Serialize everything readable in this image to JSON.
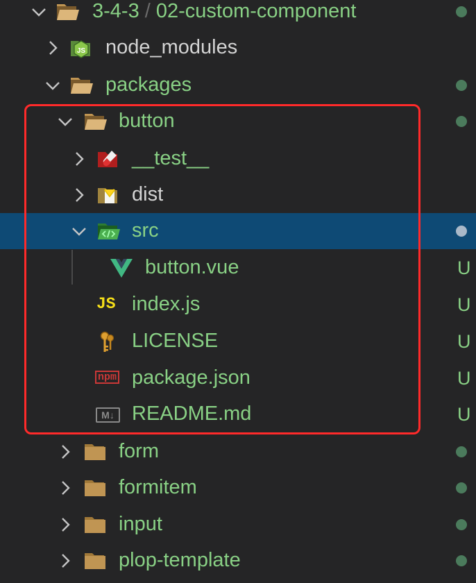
{
  "colors": {
    "untracked_green": "#89d185",
    "selection_bg": "#0e4a75",
    "highlight_border": "#ff2a2a",
    "panel_bg": "#252526"
  },
  "tree": {
    "root": {
      "name": "3-4-3",
      "separator": "/",
      "sub": "02-custom-component",
      "icon": "folder-open-icon",
      "expanded": true
    },
    "items": [
      {
        "name": "node_modules",
        "icon": "node-folder-icon",
        "expanded": false
      },
      {
        "name": "packages",
        "icon": "folder-open-icon",
        "expanded": true
      },
      {
        "name": "button",
        "icon": "folder-open-icon",
        "expanded": true
      },
      {
        "name": "__test__",
        "icon": "test-folder-icon",
        "expanded": false
      },
      {
        "name": "dist",
        "icon": "dist-folder-icon",
        "expanded": false
      },
      {
        "name": "src",
        "icon": "src-folder-icon",
        "expanded": true,
        "selected": true
      },
      {
        "name": "button.vue",
        "icon": "vue-file-icon",
        "badge": "U"
      },
      {
        "name": "index.js",
        "icon": "js-file-icon",
        "icon_text": "JS",
        "badge": "U"
      },
      {
        "name": "LICENSE",
        "icon": "license-key-icon",
        "badge": "U"
      },
      {
        "name": "package.json",
        "icon": "npm-file-icon",
        "icon_text": "npm",
        "badge": "U"
      },
      {
        "name": "README.md",
        "icon": "markdown-file-icon",
        "icon_text": "M↓",
        "badge": "U"
      },
      {
        "name": "form",
        "icon": "folder-closed-icon",
        "expanded": false
      },
      {
        "name": "formitem",
        "icon": "folder-closed-icon",
        "expanded": false
      },
      {
        "name": "input",
        "icon": "folder-closed-icon",
        "expanded": false
      },
      {
        "name": "plop-template",
        "icon": "folder-closed-icon",
        "expanded": false
      }
    ]
  }
}
